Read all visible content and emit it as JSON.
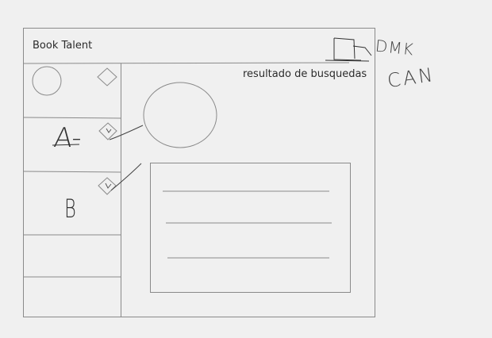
{
  "header": {
    "app_title": "Book Talent"
  },
  "sidebar": {
    "items": [
      {
        "label": ""
      },
      {
        "label": "A-"
      },
      {
        "label": "B"
      },
      {
        "label": ""
      },
      {
        "label": ""
      }
    ]
  },
  "main": {
    "results_title": "resultado de busquedas"
  },
  "annotations": {
    "top_scrawl": "DMK",
    "bottom_scrawl": "CAN"
  }
}
